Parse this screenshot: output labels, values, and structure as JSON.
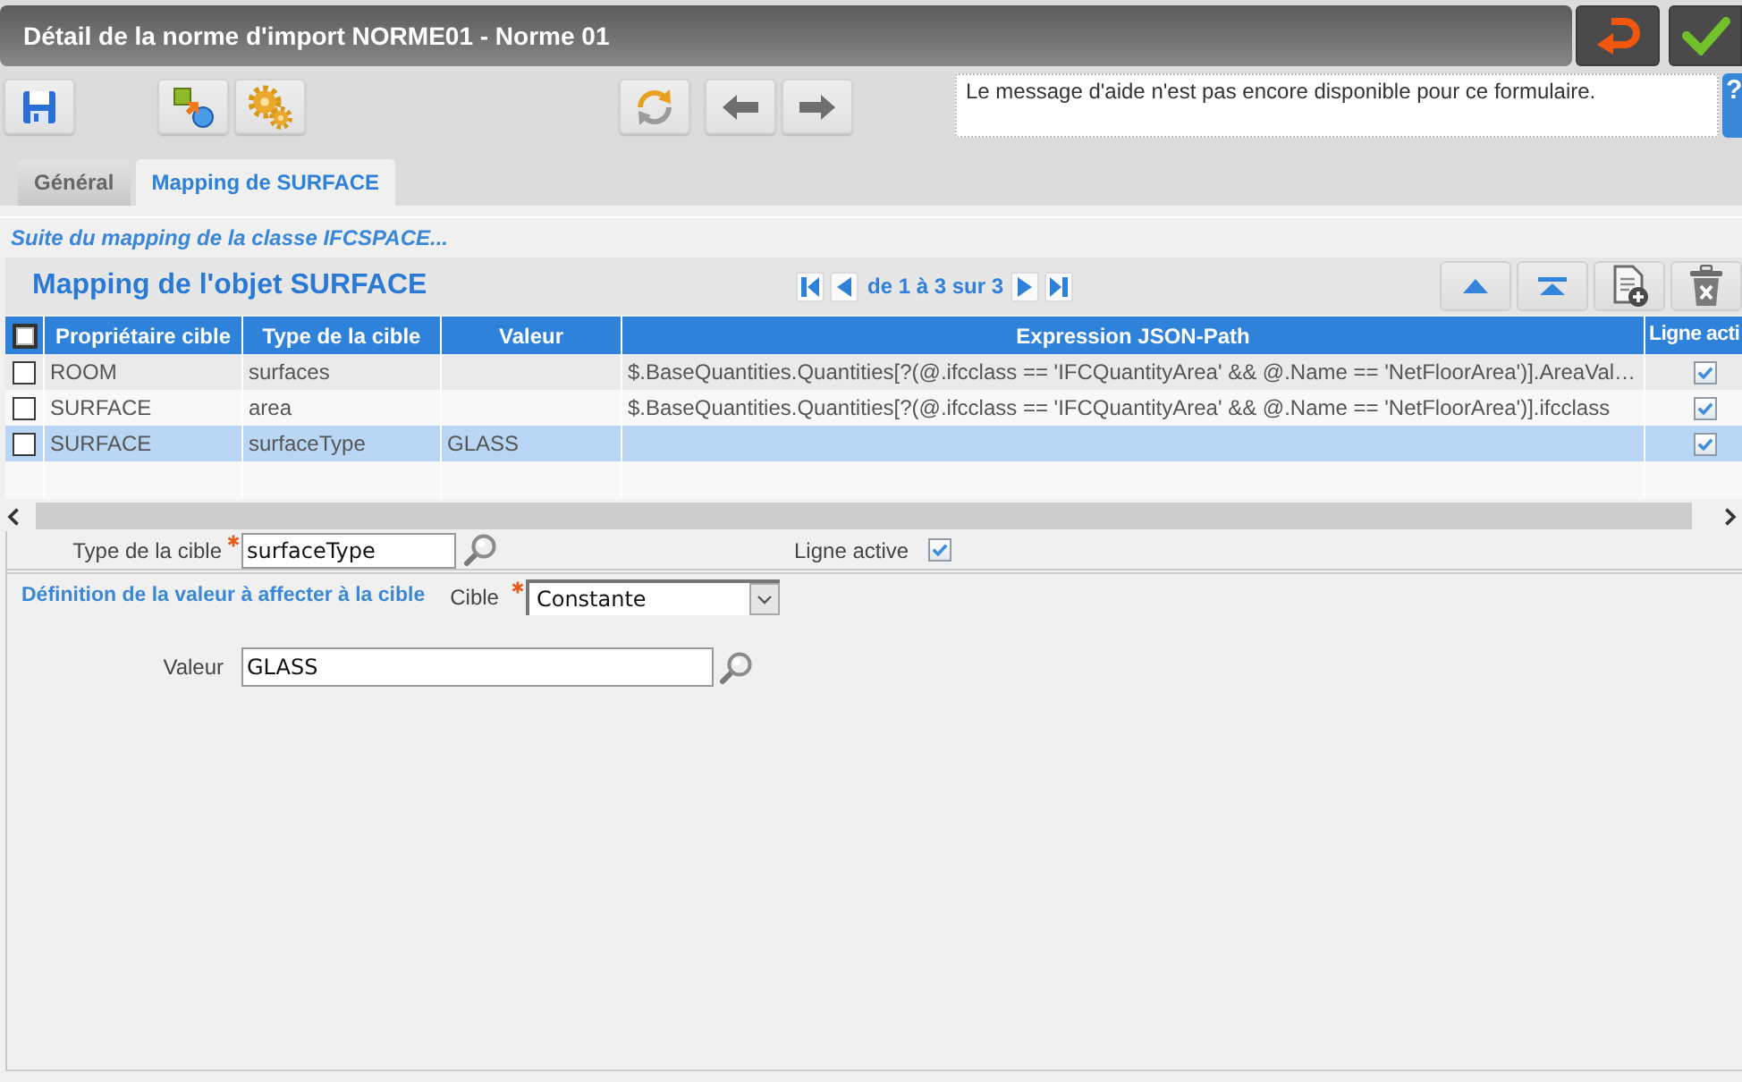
{
  "window": {
    "title": "Détail de la norme d'import NORME01 - Norme 01"
  },
  "help": {
    "message": "Le message d'aide n'est pas encore disponible pour ce formulaire.",
    "button_label": "?"
  },
  "tabs": [
    {
      "label": "Général",
      "selected": false
    },
    {
      "label": "Mapping de SURFACE",
      "selected": true
    }
  ],
  "breadcrumb": "Suite du mapping de la classe IFCSPACE...",
  "grid": {
    "title": "Mapping de l'objet SURFACE",
    "pagination": "de 1 à 3 sur 3",
    "select_all_checked": false,
    "columns": [
      "Propriétaire cible",
      "Type de la cible",
      "Valeur",
      "Expression JSON-Path",
      "Ligne acti"
    ],
    "rows": [
      {
        "selected": false,
        "checked": false,
        "owner": "ROOM",
        "target_type": "surfaces",
        "expression": "$.BaseQuantities.Quantities[?(@.ifcclass == 'IFCQuantityArea' && @.Name == 'NetFloorArea')].AreaVal…",
        "active": true
      },
      {
        "selected": false,
        "checked": false,
        "owner": "SURFACE",
        "target_type": "area",
        "expression": "$.BaseQuantities.Quantities[?(@.ifcclass == 'IFCQuantityArea' && @.Name == 'NetFloorArea')].ifcclass",
        "active": true
      },
      {
        "selected": true,
        "checked": false,
        "owner": "SURFACE",
        "target_type": "surfaceType",
        "value": "GLASS",
        "active": true
      }
    ]
  },
  "form": {
    "target_type": {
      "label": "Type de la cible",
      "required": true,
      "value": "surfaceType"
    },
    "active_line": {
      "label": "Ligne active",
      "checked": true
    },
    "value_section": {
      "title": "Définition de la valeur à affecter à la cible",
      "target": {
        "label": "Cible",
        "required": true,
        "value": "Constante"
      },
      "value": {
        "label": "Valeur",
        "value": "GLASS"
      }
    }
  }
}
